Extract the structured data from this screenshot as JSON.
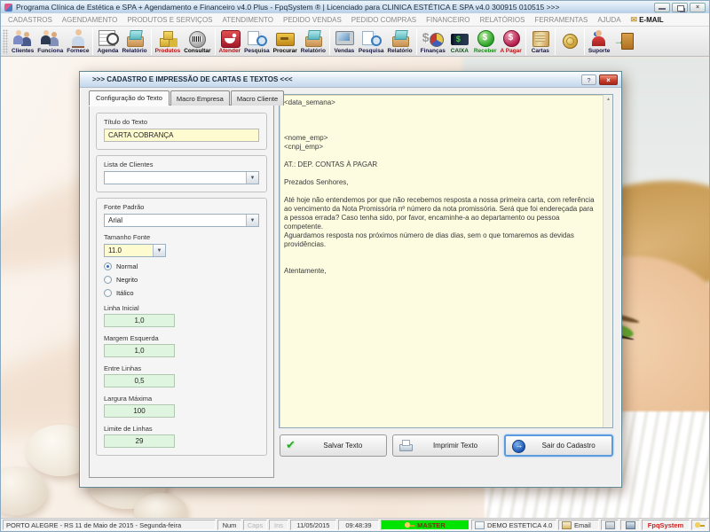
{
  "window": {
    "title": "Programa Clínica de Estética e SPA + Agendamento e Financeiro v4.0 Plus - FpqSystem ® | Licenciado para  CLINICA ESTÉTICA E SPA v4.0 300915 010515 >>>"
  },
  "menu": {
    "items": [
      "CADASTROS",
      "AGENDAMENTO",
      "PRODUTOS E SERVIÇOS",
      "ATENDIMENTO",
      "PEDIDO VENDAS",
      "PEDIDO COMPRAS",
      "FINANCEIRO",
      "RELATÓRIOS",
      "FERRAMENTAS",
      "AJUDA"
    ],
    "email": "E-MAIL"
  },
  "toolbar": {
    "items": [
      {
        "label": "Clientes",
        "icon": "clients-icon"
      },
      {
        "label": "Funciona",
        "icon": "employees-icon"
      },
      {
        "label": "Fornece",
        "icon": "suppliers-icon"
      },
      {
        "label": "Agenda",
        "icon": "calendar-icon"
      },
      {
        "label": "Relatório",
        "icon": "report-icon"
      },
      {
        "label": "Produtos",
        "icon": "products-icon"
      },
      {
        "label": "Consultar",
        "icon": "barcode-icon"
      },
      {
        "label": "Atender",
        "icon": "spa-service-icon"
      },
      {
        "label": "Pesquisa",
        "icon": "search-docs-icon"
      },
      {
        "label": "Procurar",
        "icon": "drawer-icon"
      },
      {
        "label": "Relatório",
        "icon": "report-icon"
      },
      {
        "label": "Vendas",
        "icon": "monitor-icon"
      },
      {
        "label": "Pesquisa",
        "icon": "search-docs-icon"
      },
      {
        "label": "Relatório",
        "icon": "report-icon"
      },
      {
        "label": "Finanças",
        "icon": "finance-pie-icon"
      },
      {
        "label": "CAIXA",
        "icon": "cashbook-icon"
      },
      {
        "label": "Receber",
        "icon": "dollar-green-icon"
      },
      {
        "label": "A Pagar",
        "icon": "dollar-red-icon"
      },
      {
        "label": "Cartas",
        "icon": "letters-icon"
      },
      {
        "label": "",
        "icon": "coin-icon"
      },
      {
        "label": "Suporte",
        "icon": "support-icon"
      },
      {
        "label": "",
        "icon": "exit-door-icon"
      }
    ]
  },
  "dialog": {
    "title": ">>> CADASTRO E IMPRESSÃO DE CARTAS E TEXTOS <<<",
    "help_label": "?",
    "close_label": "×",
    "tabs": [
      "Configuração do Texto",
      "Macro Empresa",
      "Macro Cliente"
    ],
    "form": {
      "titulo_label": "Título do Texto",
      "titulo_value": "CARTA COBRANÇA",
      "lista_label": "Lista de Clientes",
      "lista_value": "",
      "fonte_label": "Fonte Padrão",
      "fonte_value": "Arial",
      "tamanho_label": "Tamanho Fonte",
      "tamanho_value": "11.0",
      "style_options": [
        "Normal",
        "Negrito",
        "Itálico"
      ],
      "style_selected": "Normal",
      "linha_label": "Linha Inicial",
      "linha_value": "1,0",
      "margem_label": "Margem Esquerda",
      "margem_value": "1,0",
      "entre_label": "Entre Linhas",
      "entre_value": "0,5",
      "largura_label": "Largura Máxima",
      "largura_value": "100",
      "limite_label": "Limite de Linhas",
      "limite_value": "29"
    },
    "letter_text": "<data_semana>\n\n\n\n<nome_emp>\n<cnpj_emp>\n\nAT.: DEP. CONTAS À PAGAR\n\nPrezados Senhores,\n\nAté hoje não entendemos por que não recebemos resposta a nossa primeira carta, com referência ao vencimento da Nota Promissória nº número da nota promissória. Será que foi endereçada para a pessoa errada? Caso tenha sido, por favor, encaminhe-a ao departamento ou pessoa competente.\nAguardamos resposta nos próximos número de dias dias, sem o que tomaremos as devidas providências.\n\n\nAtentamente,",
    "buttons": {
      "save": "Salvar Texto",
      "print": "Imprimir Texto",
      "exit": "Sair do Cadastro"
    }
  },
  "statusbar": {
    "location": "PORTO ALEGRE - RS 11 de Maio de 2015 - Segunda-feira",
    "num": "Num",
    "caps": "Caps",
    "ins": "Ins",
    "date": "11/05/2015",
    "time": "09:48:39",
    "user": "MASTER",
    "company": "DEMO ESTETICA 4.0",
    "email": "Email",
    "brand": "FpqSystem"
  },
  "colors": {
    "master_badge_bg": "#00e400",
    "master_badge_text": "#8a2a12",
    "brand_text": "#cc2222",
    "letter_bg": "#fdfce1",
    "input_yellow": "#fffbd0",
    "input_green": "#dff5df",
    "dialog_close_bg": "#c33a28"
  }
}
